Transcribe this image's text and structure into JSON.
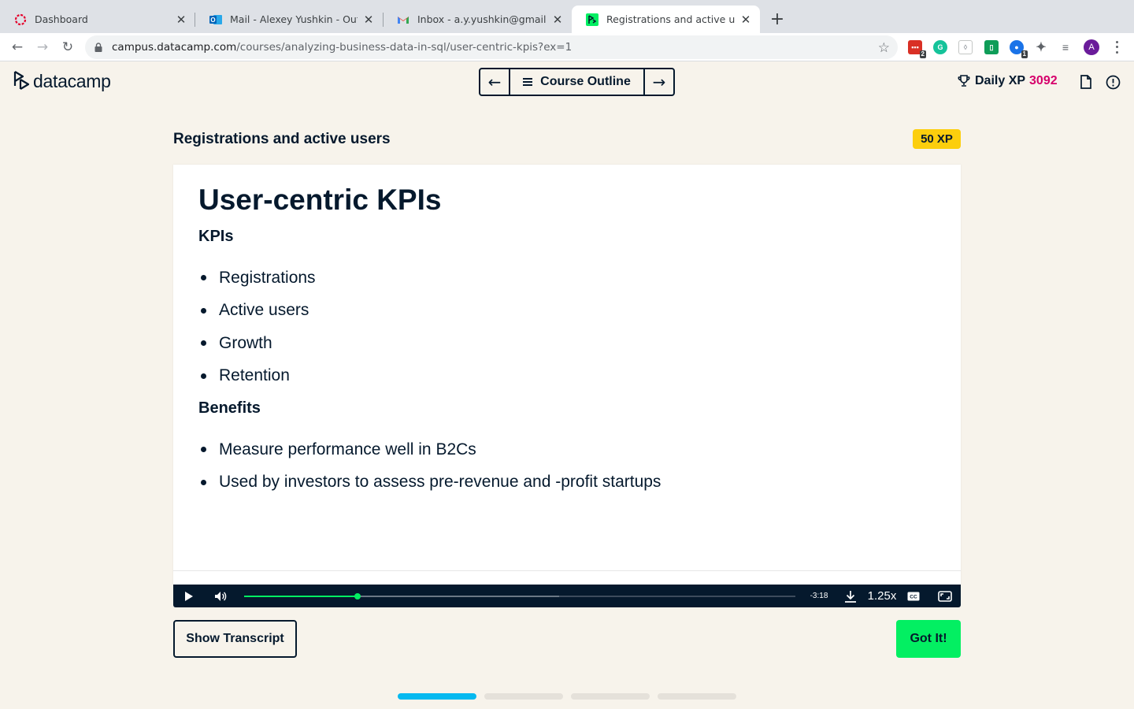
{
  "browser": {
    "tabs": [
      {
        "title": "Dashboard",
        "icon": "dashboard-favicon-icon",
        "active": false
      },
      {
        "title": "Mail - Alexey Yushkin - Outlook",
        "icon": "outlook-icon",
        "active": false
      },
      {
        "title": "Inbox - a.y.yushkin@gmail.com",
        "icon": "gmail-icon",
        "active": false
      },
      {
        "title": "Registrations and active users",
        "icon": "datacamp-favicon-icon",
        "active": true
      }
    ],
    "url_domain": "campus.datacamp.com",
    "url_path": "/courses/analyzing-business-data-in-sql/user-centric-kpis?ex=1",
    "extension_badges": {
      "ext1": "2",
      "ext6": "1"
    },
    "profile_initial": "A"
  },
  "header": {
    "logo_text": "datacamp",
    "course_outline_label": "Course Outline",
    "daily_xp_label": "Daily XP",
    "daily_xp_value": "3092"
  },
  "exercise": {
    "title": "Registrations and active users",
    "xp_badge": "50 XP"
  },
  "slide": {
    "heading": "User-centric KPIs",
    "section1_title": "KPIs",
    "section1_items": [
      "Registrations",
      "Active users",
      "Growth",
      "Retention"
    ],
    "section2_title": "Benefits",
    "section2_items": [
      "Measure performance well in B2Cs",
      "Used by investors to assess pre-revenue and -profit startups"
    ]
  },
  "player": {
    "time_remaining": "-3:18",
    "speed": "1.25x",
    "played_fraction": 0.205,
    "buffered_fraction": 0.572
  },
  "actions": {
    "transcript_label": "Show Transcript",
    "got_it_label": "Got It!"
  },
  "progress": {
    "total_steps": 4,
    "current_step": 1
  },
  "colors": {
    "accent_green": "#03ef62",
    "xp_yellow": "#fcce0d",
    "xp_pink": "#d6006b",
    "navy": "#05192d",
    "progress_blue": "#05b9f0"
  }
}
